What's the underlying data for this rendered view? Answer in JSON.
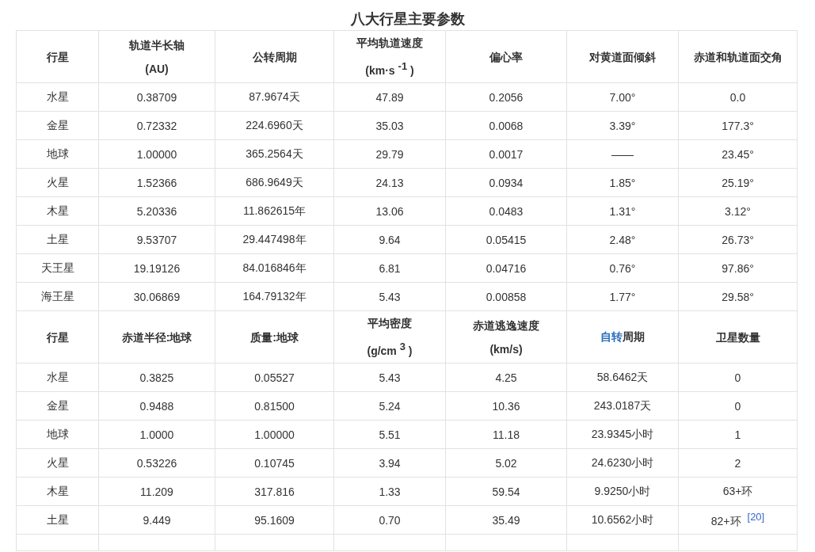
{
  "title": "八大行星主要参数",
  "sections": [
    {
      "header": [
        {
          "lines": [
            "行星"
          ]
        },
        {
          "lines": [
            "轨道半长轴",
            "(AU)"
          ]
        },
        {
          "lines": [
            "公转周期"
          ]
        },
        {
          "lines": [
            "平均轨道速度",
            "(km·s $^{-1}$ )"
          ]
        },
        {
          "lines": [
            "偏心率"
          ]
        },
        {
          "lines": [
            "对黄道面倾斜"
          ]
        },
        {
          "lines": [
            "赤道和轨道面交角"
          ]
        }
      ],
      "rows": [
        [
          "水星",
          "0.38709",
          "87.9674天",
          "47.89",
          "0.2056",
          "7.00°",
          "0.0"
        ],
        [
          "金星",
          "0.72332",
          "224.6960天",
          "35.03",
          "0.0068",
          "3.39°",
          "177.3°"
        ],
        [
          "地球",
          "1.00000",
          "365.2564天",
          "29.79",
          "0.0017",
          "——",
          "23.45°"
        ],
        [
          "火星",
          "1.52366",
          "686.9649天",
          "24.13",
          "0.0934",
          "1.85°",
          "25.19°"
        ],
        [
          "木星",
          "5.20336",
          "11.862615年",
          "13.06",
          "0.0483",
          "1.31°",
          "3.12°"
        ],
        [
          "土星",
          "9.53707",
          "29.447498年",
          "9.64",
          "0.05415",
          "2.48°",
          "26.73°"
        ],
        [
          "天王星",
          "19.19126",
          "84.016846年",
          "6.81",
          "0.04716",
          "0.76°",
          "97.86°"
        ],
        [
          "海王星",
          "30.06869",
          "164.79132年",
          "5.43",
          "0.00858",
          "1.77°",
          "29.58°"
        ]
      ]
    },
    {
      "header": [
        {
          "lines": [
            "行星"
          ]
        },
        {
          "lines": [
            "赤道半径:地球"
          ]
        },
        {
          "lines": [
            "质量:地球"
          ]
        },
        {
          "lines": [
            "平均密度",
            "(g/cm $^{3}$ )"
          ]
        },
        {
          "lines": [
            "赤道逃逸速度",
            "(km/s)"
          ]
        },
        {
          "link": "自转",
          "lines": [
            "周期"
          ]
        },
        {
          "lines": [
            "卫星数量"
          ]
        }
      ],
      "rows": [
        [
          "水星",
          "0.3825",
          "0.05527",
          "5.43",
          "4.25",
          "58.6462天",
          "0"
        ],
        [
          "金星",
          "0.9488",
          "0.81500",
          "5.24",
          "10.36",
          "243.0187天",
          "0"
        ],
        [
          "地球",
          "1.0000",
          "1.00000",
          "5.51",
          "11.18",
          "23.9345小时",
          "1"
        ],
        [
          "火星",
          "0.53226",
          "0.10745",
          "3.94",
          "5.02",
          "24.6230小时",
          "2"
        ],
        [
          "木星",
          "11.209",
          "317.816",
          "1.33",
          "59.54",
          "9.9250小时",
          "63+环"
        ],
        [
          "土星",
          "9.449",
          "95.1609",
          "0.70",
          "35.49",
          "10.6562小时",
          {
            "text": "82+环",
            "ref": "[20]"
          }
        ]
      ]
    }
  ]
}
